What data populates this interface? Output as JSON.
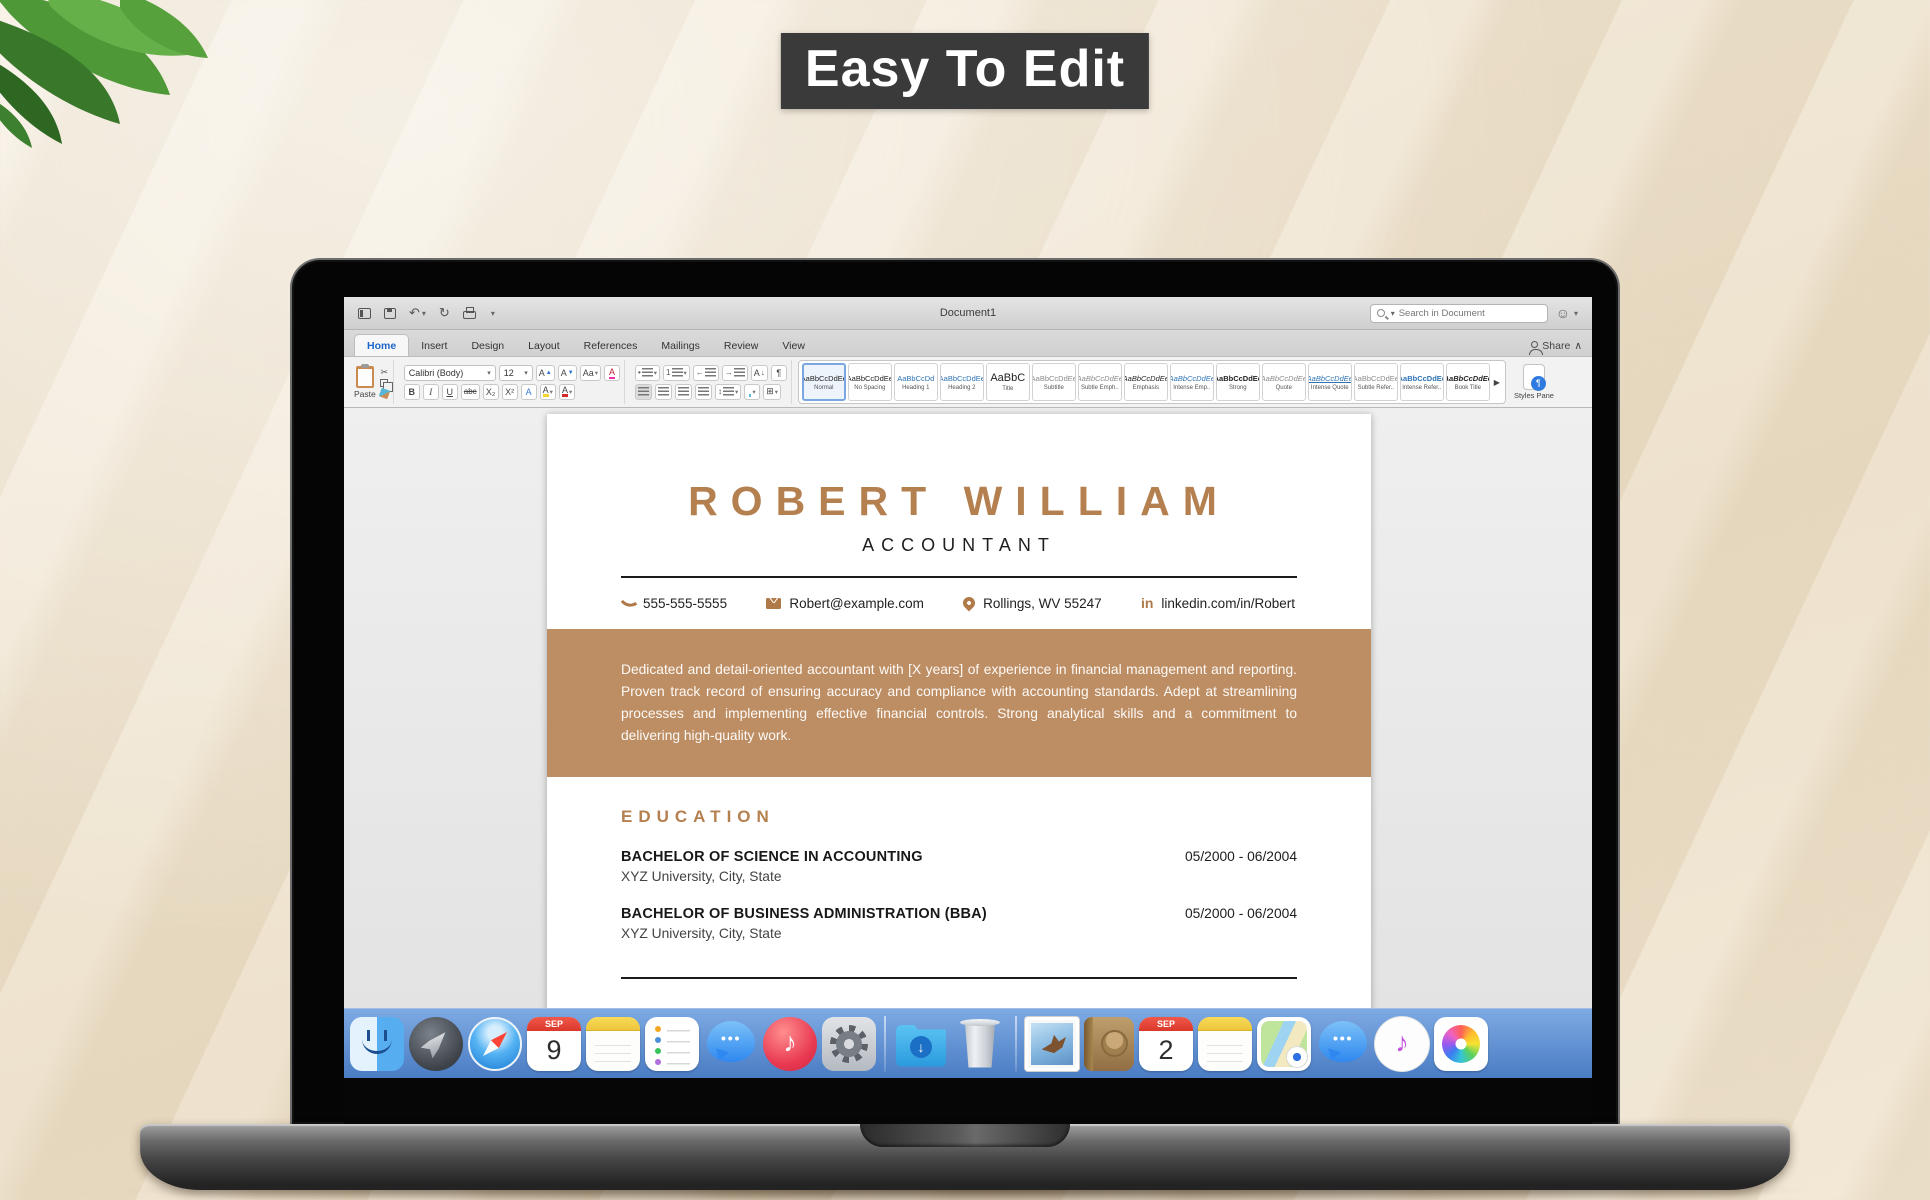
{
  "banner": {
    "title": "Easy To Edit"
  },
  "colors": {
    "accent_tan": "#b5804f",
    "summary_band": "#bd8d63",
    "banner_bg": "#3a3a3a",
    "dock_blue": "#4a7cc4",
    "active_tab_blue": "#1f66c9"
  },
  "titlebar": {
    "document_title": "Document1",
    "search_placeholder": "Search in Document"
  },
  "tabs": [
    {
      "label": "Home"
    },
    {
      "label": "Insert"
    },
    {
      "label": "Design"
    },
    {
      "label": "Layout"
    },
    {
      "label": "References"
    },
    {
      "label": "Mailings"
    },
    {
      "label": "Review"
    },
    {
      "label": "View"
    }
  ],
  "share_label": "Share",
  "ribbon": {
    "paste_label": "Paste",
    "font_name": "Calibri (Body)",
    "font_size": "12",
    "format": {
      "bold": "B",
      "italic": "I",
      "underline": "U",
      "strike": "abc",
      "sub": "X₂",
      "sup": "X²",
      "grow": "A",
      "shrink": "A",
      "case": "Aa",
      "color": "A",
      "highlight": "A",
      "effects": "A"
    },
    "styles": [
      {
        "sample": "AaBbCcDdEe",
        "label": "Normal"
      },
      {
        "sample": "AaBbCcDdEe",
        "label": "No Spacing"
      },
      {
        "sample": "AaBbCcDd",
        "label": "Heading 1"
      },
      {
        "sample": "AaBbCcDdEe",
        "label": "Heading 2"
      },
      {
        "sample": "AaBbC",
        "label": "Title"
      },
      {
        "sample": "AaBbCcDdEe",
        "label": "Subtitle"
      },
      {
        "sample": "AaBbCcDdEe",
        "label": "Subtle Emph.."
      },
      {
        "sample": "AaBbCcDdEe",
        "label": "Emphasis"
      },
      {
        "sample": "AaBbCcDdEe",
        "label": "Intense Emp.."
      },
      {
        "sample": "AaBbCcDdEe",
        "label": "Strong"
      },
      {
        "sample": "AaBbCcDdEe",
        "label": "Quote"
      },
      {
        "sample": "AaBbCcDdEe",
        "label": "Intense Quote"
      },
      {
        "sample": "AaBbCcDdEe",
        "label": "Subtle Refer.."
      },
      {
        "sample": "AaBbCcDdEe",
        "label": "Intense Refer.."
      },
      {
        "sample": "AaBbCcDdEe",
        "label": "Book Title"
      }
    ],
    "styles_pane_label": "Styles Pane"
  },
  "glyphs": {
    "dropdown": "▾",
    "undo": "↶",
    "redo": "↻",
    "scissors": "✂",
    "paragraph_mark": "¶",
    "bullet": "•",
    "number_one": "1",
    "arrow_left": "←",
    "arrow_right": "→",
    "updown": "↕",
    "sort_letter": "A",
    "arrow_down": "↓",
    "grid": "⊞",
    "overflow": "▶",
    "chevron_up": "∧",
    "smiley": "☺",
    "plus": "+",
    "search_dd": "▾"
  },
  "resume": {
    "name": "ROBERT WILLIAM",
    "role": "ACCOUNTANT",
    "contacts": [
      {
        "icon": "phone-icon",
        "text": "555-555-5555"
      },
      {
        "icon": "email-icon",
        "text": "Robert@example.com"
      },
      {
        "icon": "location-icon",
        "text": "Rollings, WV 55247"
      },
      {
        "icon": "linkedin-icon",
        "text": "linkedin.com/in/Robert"
      }
    ],
    "linkedin_glyph": "in",
    "summary": "Dedicated and detail-oriented accountant with [X years] of experience in financial management and reporting. Proven track record of ensuring accuracy and compliance with accounting standards. Adept at streamlining processes and implementing effective financial controls. Strong analytical skills and a commitment to delivering high-quality work.",
    "education": {
      "heading": "EDUCATION",
      "items": [
        {
          "degree": "BACHELOR OF SCIENCE IN ACCOUNTING",
          "dates": "05/2000 - 06/2004",
          "school": "XYZ University, City, State"
        },
        {
          "degree": "BACHELOR OF BUSINESS ADMINISTRATION (BBA)",
          "dates": "05/2000 - 06/2004",
          "school": "XYZ University, City, State"
        }
      ]
    }
  },
  "dock": {
    "calendar1": {
      "month": "SEP",
      "day": "9"
    },
    "calendar2": {
      "month": "SEP",
      "day": "2"
    }
  }
}
